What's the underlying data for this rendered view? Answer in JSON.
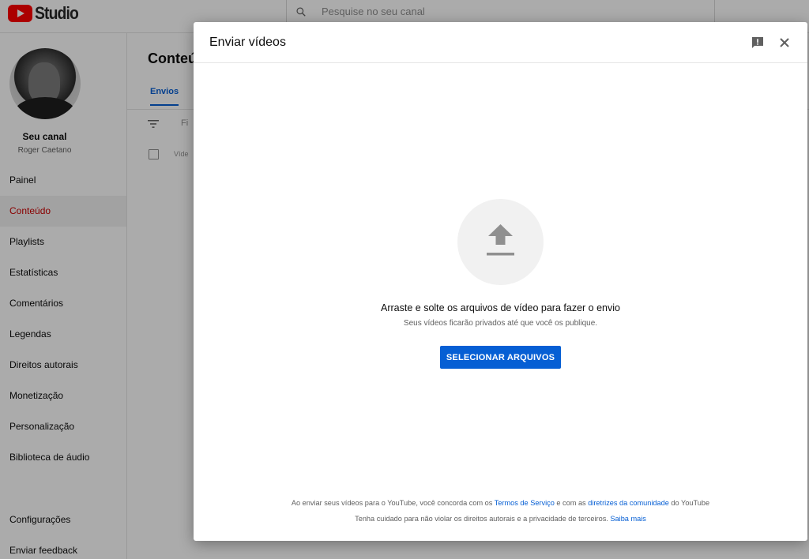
{
  "app": {
    "logo_text": "Studio"
  },
  "search": {
    "placeholder": "Pesquise no seu canal"
  },
  "sidebar": {
    "channel_label": "Seu canal",
    "channel_user": "Roger Caetano",
    "items": [
      {
        "label": "Painel"
      },
      {
        "label": "Conteúdo",
        "active": true
      },
      {
        "label": "Playlists"
      },
      {
        "label": "Estatísticas"
      },
      {
        "label": "Comentários"
      },
      {
        "label": "Legendas"
      },
      {
        "label": "Direitos autorais"
      },
      {
        "label": "Monetização"
      },
      {
        "label": "Personalização"
      },
      {
        "label": "Biblioteca de áudio"
      }
    ],
    "bottom_items": [
      {
        "label": "Configurações"
      },
      {
        "label": "Enviar feedback"
      }
    ]
  },
  "main": {
    "title": "Conteú",
    "tab_label": "Envios",
    "filter_text": "Fi",
    "row_text": "Víde"
  },
  "dialog": {
    "title": "Enviar vídeos",
    "drop_text": "Arraste e solte os arquivos de vídeo para fazer o envio",
    "drop_subtext": "Seus vídeos ficarão privados até que você os publique.",
    "select_button": "SELECIONAR ARQUIVOS",
    "legal": {
      "line1_prefix": "Ao enviar seus vídeos para o YouTube, você concorda com os ",
      "terms_link": "Termos de Serviço",
      "line1_middle": " e com as ",
      "guidelines_link": "diretrizes da comunidade",
      "line1_suffix": " do YouTube",
      "line2_prefix": "Tenha cuidado para não violar os direitos autorais e a privacidade de terceiros. ",
      "learn_more_link": "Saiba mais"
    }
  },
  "edge_chars": [
    "A",
    "A"
  ],
  "colors": {
    "accent": "#065fd4",
    "brand_red": "#ff0000",
    "active_nav": "#cc0000"
  }
}
